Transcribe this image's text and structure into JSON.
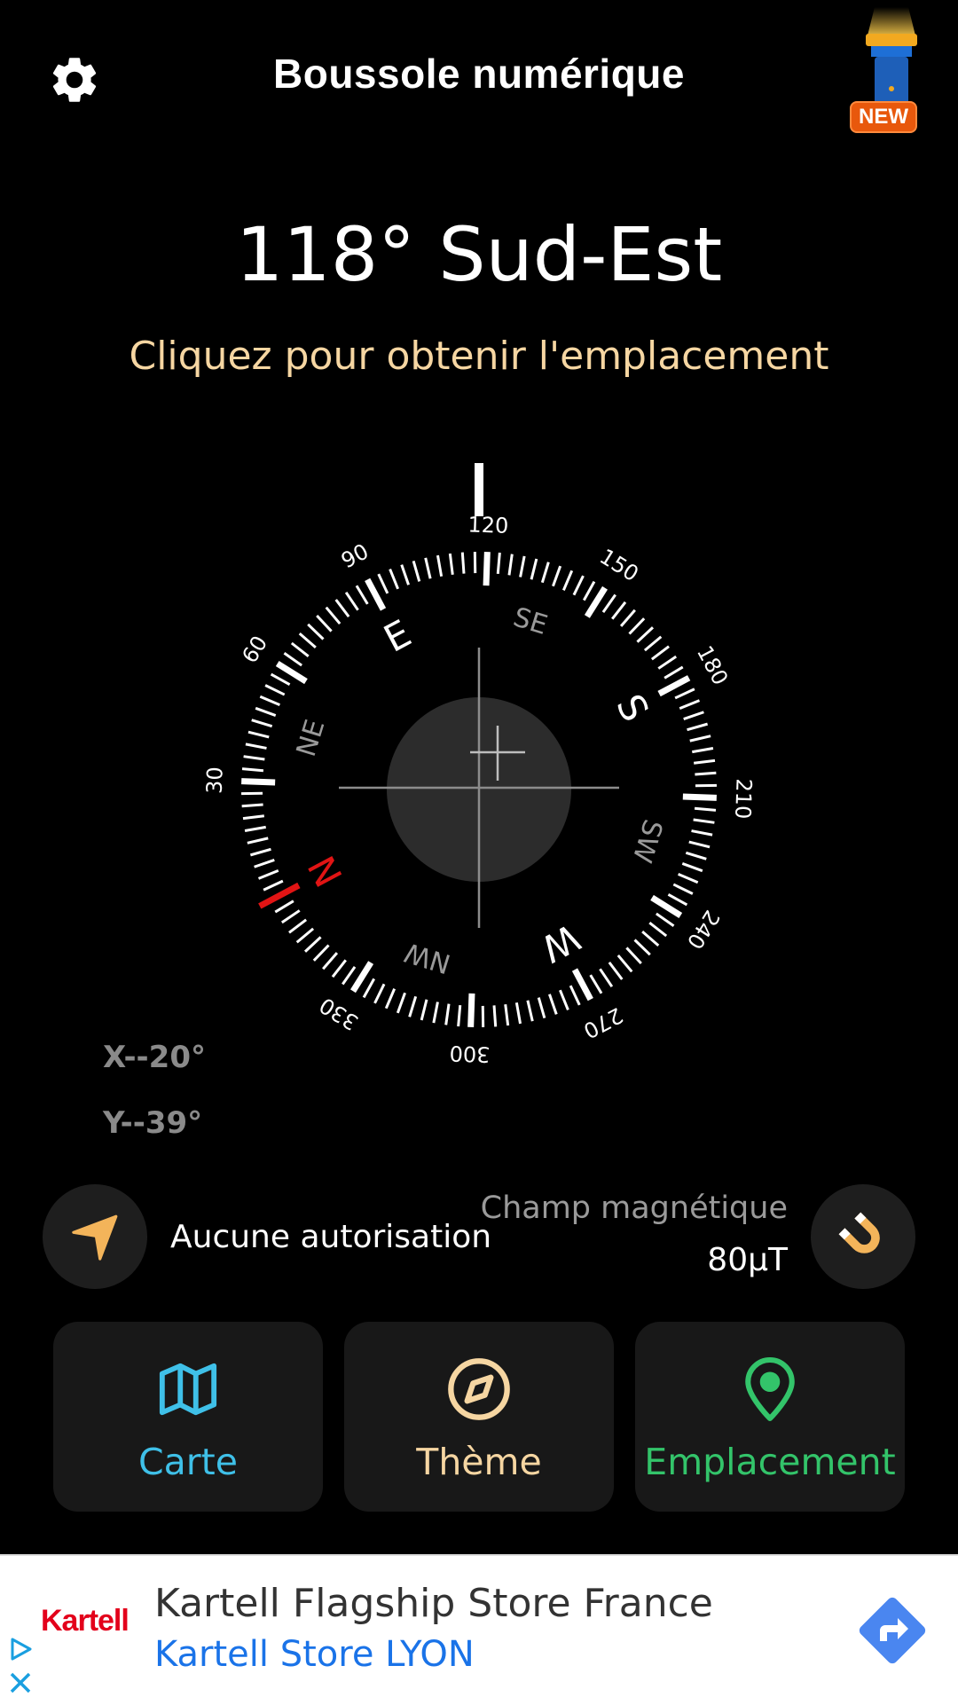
{
  "header": {
    "title": "Boussole numérique",
    "new_badge": "NEW"
  },
  "heading": {
    "degrees": "118°",
    "direction": "Sud-Est",
    "value": 118
  },
  "location_prompt": "Cliquez pour obtenir l'emplacement",
  "compass": {
    "cardinals": [
      "N",
      "E",
      "S",
      "W"
    ],
    "intercardinals": [
      "NE",
      "SE",
      "SW",
      "NW"
    ],
    "degree_labels": [
      "30",
      "60",
      "90",
      "120",
      "150",
      "180",
      "210",
      "240",
      "270",
      "300",
      "330"
    ],
    "north_color": "#e11414"
  },
  "tilt": {
    "x": "X--20°",
    "y": "Y--39°"
  },
  "status": {
    "permission": "Aucune autorisation",
    "magnetic_label": "Champ magnétique",
    "magnetic_value": "80μT"
  },
  "actions": [
    {
      "label": "Carte",
      "icon": "map-icon",
      "color": "#3fc0e8"
    },
    {
      "label": "Thème",
      "icon": "compass-theme-icon",
      "color": "#f6d6a2"
    },
    {
      "label": "Emplacement",
      "icon": "location-pin-icon",
      "color": "#33c46a"
    }
  ],
  "ad": {
    "brand": "Kartell",
    "title": "Kartell Flagship Store France",
    "subtitle": "Kartell Store LYON",
    "action_color": "#4a86f0"
  }
}
